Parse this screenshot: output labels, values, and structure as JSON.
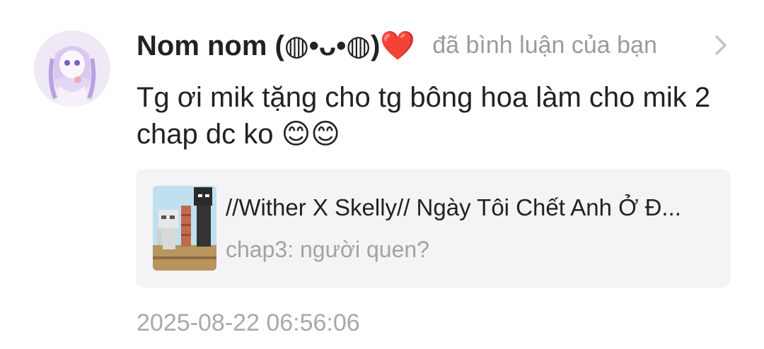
{
  "comment": {
    "user_name": "Nom nom (◍•ᴗ•◍)❤️",
    "action_text": "đã bình luận của bạn",
    "text": "Tg ơi mik tặng cho tg bông hoa làm cho mik 2 chap dc ko 😊😊",
    "timestamp": "2025-08-22 06:56:06"
  },
  "story": {
    "title": "//Wither X Skelly// Ngày Tôi Chết Anh Ở Đ...",
    "chapter": "chap3: người quen?"
  },
  "icons": {
    "chevron": "chevron-right-icon"
  }
}
